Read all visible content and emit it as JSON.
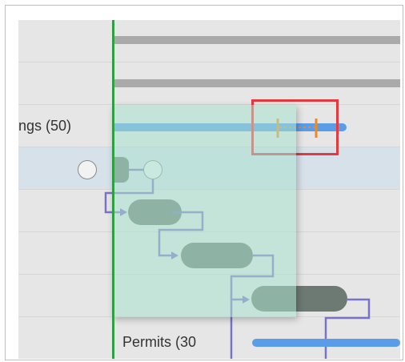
{
  "rows": [
    {
      "id": "row-1",
      "label": ""
    },
    {
      "id": "row-2",
      "label": ""
    },
    {
      "id": "row-3",
      "label": "ngs (50)"
    },
    {
      "id": "row-4",
      "label": "",
      "selected": true
    },
    {
      "id": "row-5",
      "label": ""
    },
    {
      "id": "row-6",
      "label": ""
    },
    {
      "id": "row-7",
      "label": ""
    },
    {
      "id": "row-8",
      "label": "Permits (30"
    }
  ],
  "colors": {
    "today_line": "#2ea043",
    "summary_bar": "#aaaaaa",
    "progress_bar": "#5b9ce8",
    "task_bar": "#6d7a74",
    "dependency_arrow": "#7a72c4",
    "baseline_marker": "#f08a1c",
    "highlight": "#e3393f",
    "drag_overlay": "#aae1cd"
  },
  "icons": {
    "milestone_start": "circle-milestone-icon",
    "milestone_end": "circle-milestone-icon",
    "dependency": "arrow-right-icon"
  }
}
